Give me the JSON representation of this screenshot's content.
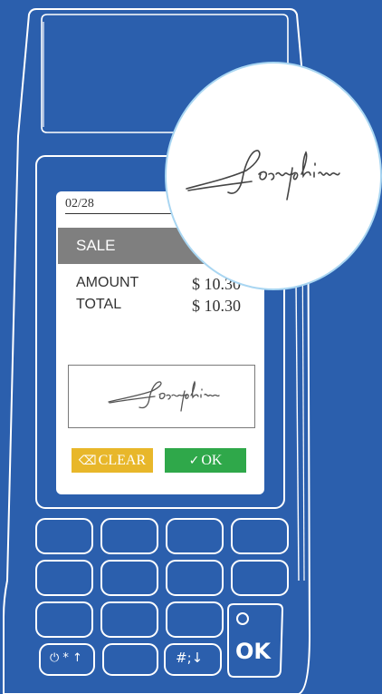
{
  "screen": {
    "date": "02/28",
    "sale_label": "SALE",
    "amount_label": "AMOUNT",
    "amount_value": "$ 10.30",
    "total_label": "TOTAL",
    "total_value": "$ 10.30",
    "signature_name": "Josephine",
    "clear_label": "CLEAR",
    "ok_label": "OK"
  },
  "keypad": {
    "power_star_label": "⏻ * ↑",
    "hash_label": "#;↓",
    "ok_key_label": "OK"
  },
  "callout": {
    "signature_name": "Josephine"
  },
  "colors": {
    "background": "#2b5fad",
    "outline": "#ffffff",
    "sale_bar": "#7f7f7f",
    "clear_button": "#e8b72a",
    "ok_button": "#2fa84a",
    "callout_border": "#a9d6f2"
  },
  "icons": {
    "clear": "eraser-icon",
    "ok": "check-circle-icon",
    "power": "power-icon"
  }
}
